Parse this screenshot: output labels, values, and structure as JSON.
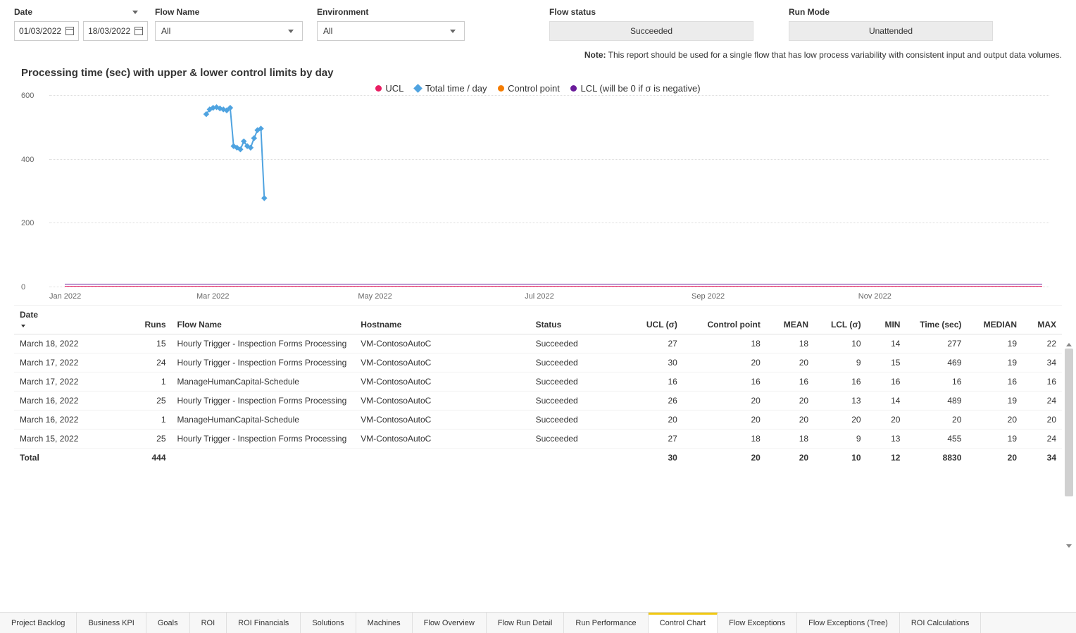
{
  "filters": {
    "date": {
      "label": "Date",
      "start": "01/03/2022",
      "end": "18/03/2022"
    },
    "flow_name": {
      "label": "Flow Name",
      "value": "All"
    },
    "environment": {
      "label": "Environment",
      "value": "All"
    },
    "flow_status": {
      "label": "Flow status",
      "value": "Succeeded"
    },
    "run_mode": {
      "label": "Run Mode",
      "value": "Unattended"
    }
  },
  "note": {
    "prefix": "Note:",
    "text": " This report should be used for a single flow that has low process variability with consistent input and output data volumes."
  },
  "chart_data": {
    "type": "line",
    "title": "Processing time (sec) with upper & lower control limits by day",
    "xlabel": "",
    "ylabel": "",
    "ylim": [
      0,
      600
    ],
    "x_range": [
      "Jan 2022",
      "Dec 2022"
    ],
    "x_ticks": [
      "Jan 2022",
      "Mar 2022",
      "May 2022",
      "Jul 2022",
      "Sep 2022",
      "Nov 2022"
    ],
    "y_ticks": [
      0,
      200,
      400,
      600
    ],
    "series": [
      {
        "name": "UCL",
        "color": "#e91e63",
        "marker": "circle",
        "values_constant": 30
      },
      {
        "name": "Total time / day",
        "color": "#4fa3e0",
        "marker": "diamond",
        "x": [
          "2022-03-01",
          "2022-03-02",
          "2022-03-03",
          "2022-03-04",
          "2022-03-05",
          "2022-03-06",
          "2022-03-07",
          "2022-03-08",
          "2022-03-09",
          "2022-03-10",
          "2022-03-11",
          "2022-03-12",
          "2022-03-13",
          "2022-03-14",
          "2022-03-15",
          "2022-03-16",
          "2022-03-17",
          "2022-03-18"
        ],
        "values": [
          540,
          555,
          560,
          562,
          558,
          555,
          552,
          560,
          440,
          435,
          430,
          455,
          440,
          435,
          465,
          490,
          495,
          277
        ]
      },
      {
        "name": "Control point",
        "color": "#f57c00",
        "marker": "circle",
        "values_constant": 20
      },
      {
        "name": "LCL (will be 0 if σ is negative)",
        "color": "#6a1b9a",
        "marker": "circle",
        "values_constant": 10
      }
    ]
  },
  "table": {
    "headers": [
      "Date",
      "Runs",
      "Flow Name",
      "Hostname",
      "Status",
      "UCL (σ)",
      "Control point",
      "MEAN",
      "LCL (σ)",
      "MIN",
      "Time (sec)",
      "MEDIAN",
      "MAX"
    ],
    "rows": [
      {
        "date": "March 18, 2022",
        "runs": 15,
        "flow": "Hourly Trigger - Inspection Forms Processing",
        "host": "VM-ContosoAutoC",
        "status": "Succeeded",
        "ucl": 27,
        "cp": 18,
        "mean": 18,
        "lcl": 10,
        "min": 14,
        "time": 277,
        "median": 19,
        "max": 22
      },
      {
        "date": "March 17, 2022",
        "runs": 24,
        "flow": "Hourly Trigger - Inspection Forms Processing",
        "host": "VM-ContosoAutoC",
        "status": "Succeeded",
        "ucl": 30,
        "cp": 20,
        "mean": 20,
        "lcl": 9,
        "min": 15,
        "time": 469,
        "median": 19,
        "max": 34
      },
      {
        "date": "March 17, 2022",
        "runs": 1,
        "flow": "ManageHumanCapital-Schedule",
        "host": "VM-ContosoAutoC",
        "status": "Succeeded",
        "ucl": 16,
        "cp": 16,
        "mean": 16,
        "lcl": 16,
        "min": 16,
        "time": 16,
        "median": 16,
        "max": 16
      },
      {
        "date": "March 16, 2022",
        "runs": 25,
        "flow": "Hourly Trigger - Inspection Forms Processing",
        "host": "VM-ContosoAutoC",
        "status": "Succeeded",
        "ucl": 26,
        "cp": 20,
        "mean": 20,
        "lcl": 13,
        "min": 14,
        "time": 489,
        "median": 19,
        "max": 24
      },
      {
        "date": "March 16, 2022",
        "runs": 1,
        "flow": "ManageHumanCapital-Schedule",
        "host": "VM-ContosoAutoC",
        "status": "Succeeded",
        "ucl": 20,
        "cp": 20,
        "mean": 20,
        "lcl": 20,
        "min": 20,
        "time": 20,
        "median": 20,
        "max": 20
      },
      {
        "date": "March 15, 2022",
        "runs": 25,
        "flow": "Hourly Trigger - Inspection Forms Processing",
        "host": "VM-ContosoAutoC",
        "status": "Succeeded",
        "ucl": 27,
        "cp": 18,
        "mean": 18,
        "lcl": 9,
        "min": 13,
        "time": 455,
        "median": 19,
        "max": 24
      }
    ],
    "total": {
      "label": "Total",
      "runs": 444,
      "ucl": 30,
      "cp": 20,
      "mean": 20,
      "lcl": 10,
      "min": 12,
      "time": 8830,
      "median": 20,
      "max": 34
    }
  },
  "tabs": [
    "Project Backlog",
    "Business KPI",
    "Goals",
    "ROI",
    "ROI Financials",
    "Solutions",
    "Machines",
    "Flow Overview",
    "Flow Run Detail",
    "Run Performance",
    "Control Chart",
    "Flow Exceptions",
    "Flow Exceptions (Tree)",
    "ROI Calculations"
  ],
  "active_tab": "Control Chart"
}
